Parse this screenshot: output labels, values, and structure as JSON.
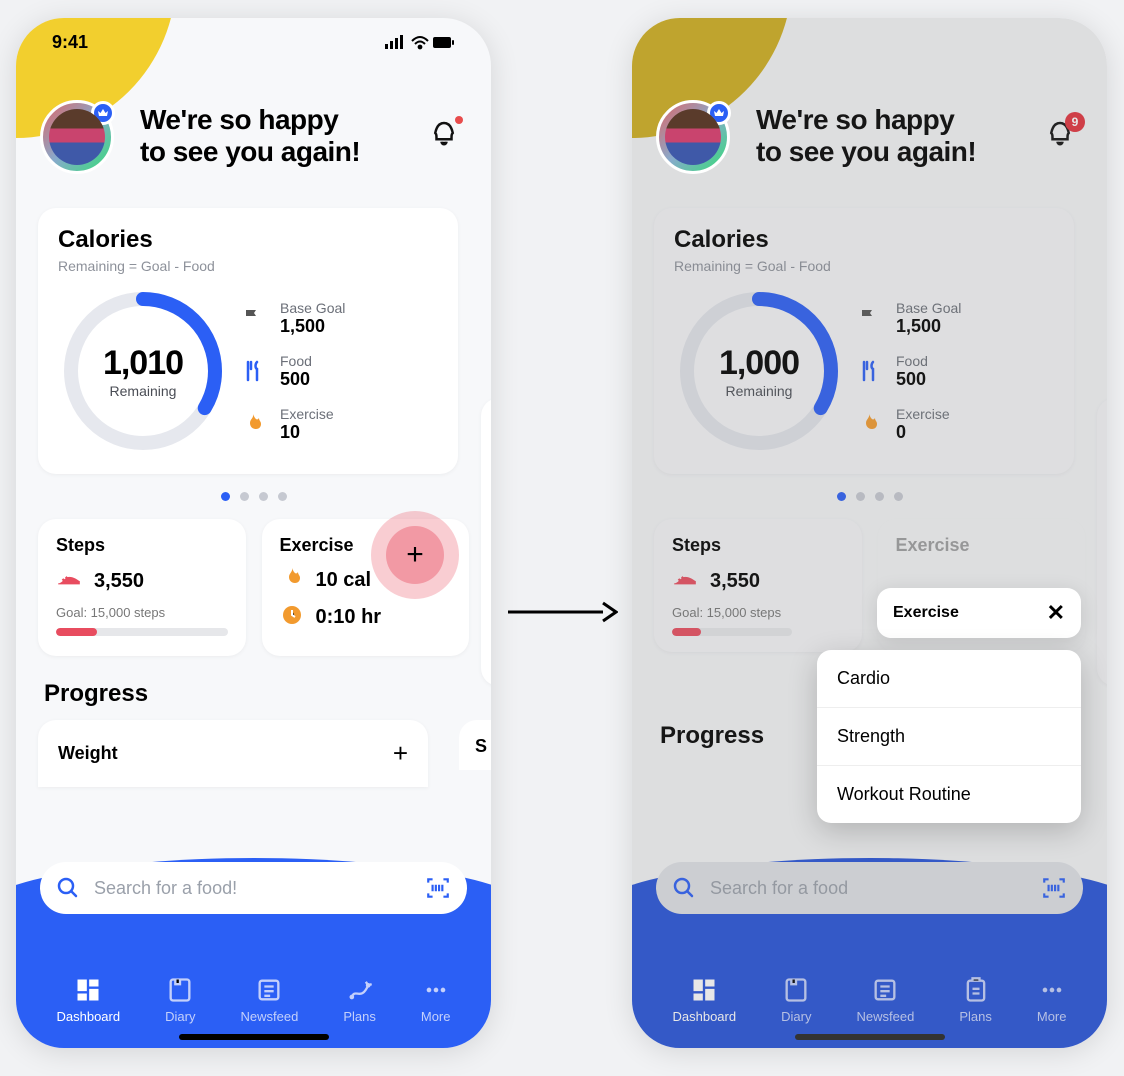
{
  "status_bar": {
    "time": "9:41"
  },
  "greeting": {
    "line1": "We're so happy",
    "line2": "to see you again!"
  },
  "notification_badge_right": "9",
  "calories": {
    "title": "Calories",
    "subtitle": "Remaining = Goal - Food",
    "remaining_left": "1,010",
    "remaining_right": "1,000",
    "remaining_label": "Remaining",
    "metrics": {
      "base_goal": {
        "label": "Base Goal",
        "value": "1,500"
      },
      "food": {
        "label": "Food",
        "value": "500"
      },
      "exercise_left": {
        "label": "Exercise",
        "value": "10"
      },
      "exercise_right": {
        "label": "Exercise",
        "value": "0"
      }
    }
  },
  "steps": {
    "title": "Steps",
    "value": "3,550",
    "goal": "Goal: 15,000 steps"
  },
  "exercise_card": {
    "title": "Exercise",
    "cal": "10 cal",
    "time": "0:10 hr"
  },
  "section_progress": "Progress",
  "weight_card": {
    "title": "Weight",
    "peek": "S"
  },
  "search": {
    "placeholder_left": "Search for a food!",
    "placeholder_right": "Search for a food"
  },
  "tabs": {
    "dashboard": "Dashboard",
    "diary": "Diary",
    "newsfeed": "Newsfeed",
    "plans": "Plans",
    "more": "More"
  },
  "popup": {
    "header": "Exercise",
    "items": {
      "cardio": "Cardio",
      "strength": "Strength",
      "routine": "Workout Routine"
    }
  },
  "colors": {
    "accent": "#2b5ff5",
    "flame": "#f29a2e",
    "pink": "#e84c5f"
  }
}
